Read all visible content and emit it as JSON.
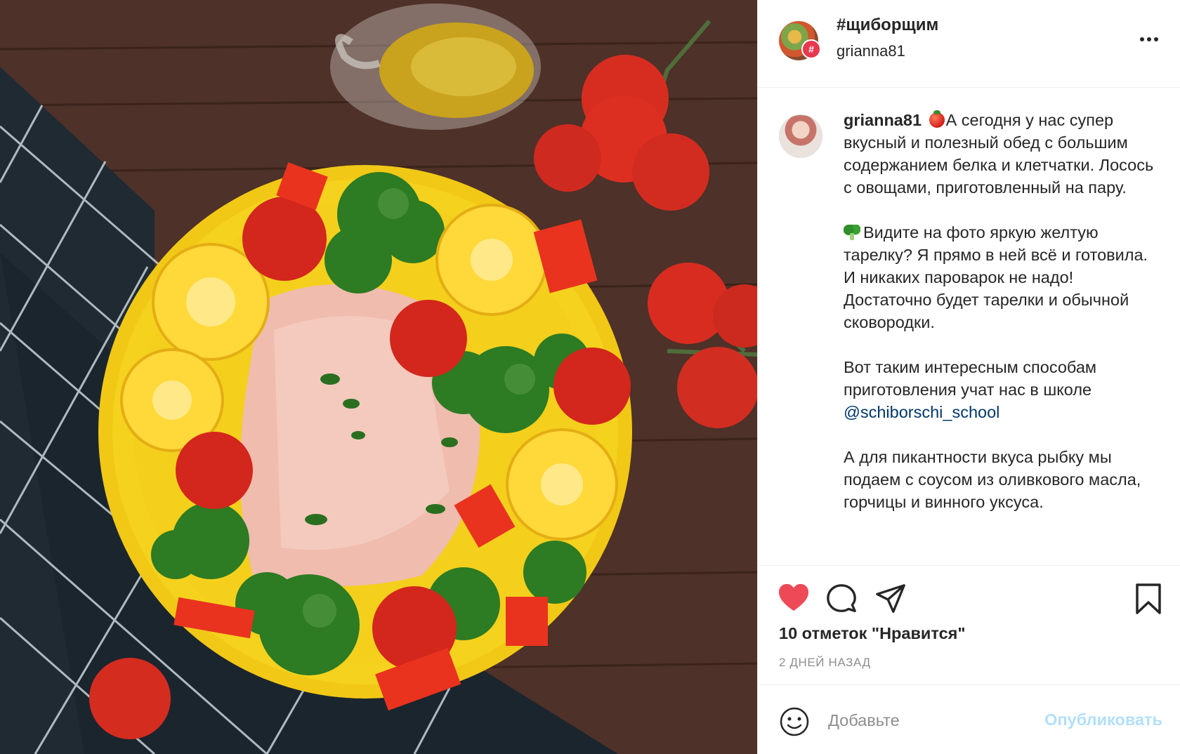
{
  "post": {
    "image_alt": "Лосось с овощами на желтой тарелке",
    "header": {
      "title": "#щиборщим",
      "username": "grianna81",
      "badge": "#"
    },
    "caption": {
      "username": "grianna81",
      "p1_text": "А сегодня у нас супер вкусный и полезный обед с большим содержанием белка и клетчатки. Лосось с овощами, приготовленный на пару.",
      "p2_text": "Видите на фото яркую желтую тарелку? Я прямо в ней всё и готовила. И никаких пароварок не надо! Достаточно будет тарелки и обычной сковородки.",
      "p3_text": "Вот таким интересным способам приготовления учат нас в школе",
      "p3_mention": "@schiborschi_school",
      "p4_text": "А для пикантности вкуса рыбку мы подаем с соусом из оливкового масла, горчицы и винного уксуса."
    },
    "actions": {
      "likes": "10 отметок \"Нравится\"",
      "timestamp": "2 ДНЕЙ НАЗАД",
      "liked": true
    },
    "comment": {
      "placeholder": "Добавьте",
      "publish_label": "Опубликовать"
    }
  },
  "colors": {
    "like_red": "#ed4956",
    "text": "#262626",
    "muted": "#8e8e8e",
    "link": "#00376b",
    "publish_disabled": "#b2dffc"
  },
  "icons": [
    "hashtag-avatar-icon",
    "more-options-icon",
    "heart-icon",
    "comment-icon",
    "share-icon",
    "bookmark-icon",
    "emoji-icon"
  ]
}
